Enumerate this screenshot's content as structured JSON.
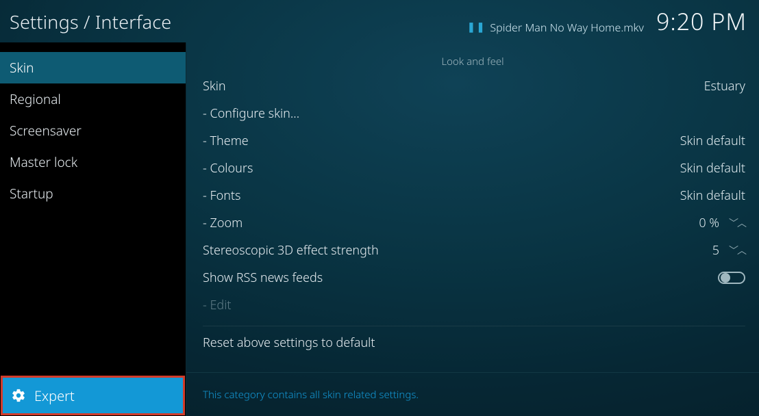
{
  "header": {
    "breadcrumb": "Settings / Interface",
    "now_playing": "Spider Man No Way Home.mkv",
    "clock": "9:20 PM"
  },
  "sidebar": {
    "items": [
      {
        "label": "Skin",
        "active": true
      },
      {
        "label": "Regional"
      },
      {
        "label": "Screensaver"
      },
      {
        "label": "Master lock"
      },
      {
        "label": "Startup"
      }
    ],
    "level_label": "Expert"
  },
  "main": {
    "section_title": "Look and feel",
    "rows": {
      "skin": {
        "label": "Skin",
        "value": "Estuary"
      },
      "configure": {
        "label": "- Configure skin..."
      },
      "theme": {
        "label": "- Theme",
        "value": "Skin default"
      },
      "colours": {
        "label": "- Colours",
        "value": "Skin default"
      },
      "fonts": {
        "label": "- Fonts",
        "value": "Skin default"
      },
      "zoom": {
        "label": "- Zoom",
        "value": "0 %"
      },
      "stereo": {
        "label": "Stereoscopic 3D effect strength",
        "value": "5"
      },
      "rss": {
        "label": "Show RSS news feeds",
        "on": false
      },
      "edit": {
        "label": "- Edit"
      },
      "reset": {
        "label": "Reset above settings to default"
      }
    },
    "description": "This category contains all skin related settings."
  }
}
